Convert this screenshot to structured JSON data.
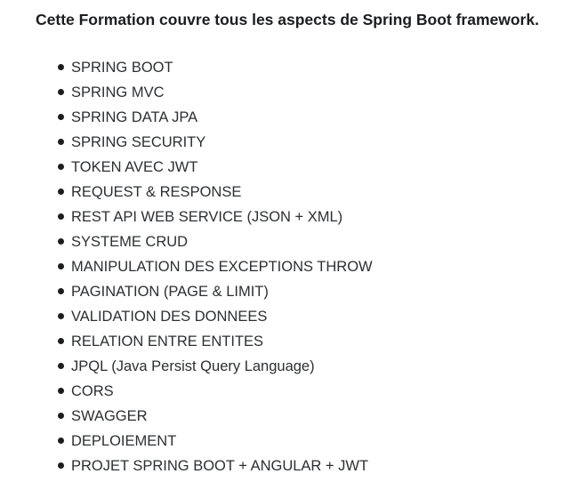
{
  "heading": "Cette Formation couvre tous les aspects de Spring Boot framework.",
  "topics": [
    "SPRING BOOT",
    "SPRING MVC",
    "SPRING DATA JPA",
    "SPRING SECURITY",
    "TOKEN AVEC JWT",
    "REQUEST & RESPONSE",
    "REST API WEB SERVICE (JSON + XML)",
    "SYSTEME CRUD",
    "MANIPULATION DES EXCEPTIONS THROW",
    "PAGINATION (PAGE & LIMIT)",
    "VALIDATION DES DONNEES",
    "RELATION ENTRE ENTITES",
    "JPQL (Java Persist Query Language)",
    "CORS",
    "SWAGGER",
    "DEPLOIEMENT",
    "PROJET SPRING BOOT + ANGULAR + JWT"
  ],
  "colors": {
    "text": "#1c1d1f",
    "list_text": "#2d2f31",
    "background": "#ffffff"
  },
  "icons": {
    "bullet": "bullet-dot-icon"
  }
}
